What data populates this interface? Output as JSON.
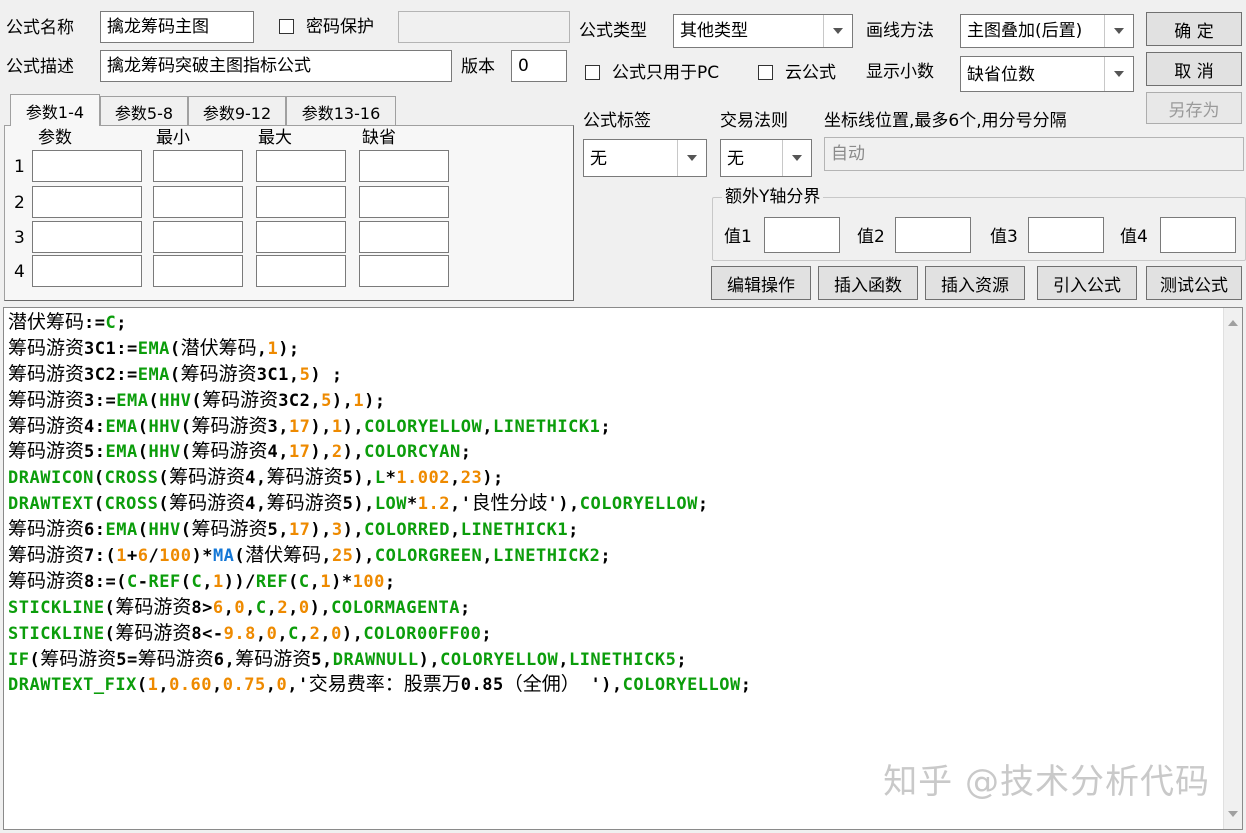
{
  "formula": {
    "name_label": "公式名称",
    "name_value": "擒龙筹码主图",
    "password_label": "密码保护",
    "password_value": "",
    "desc_label": "公式描述",
    "desc_value": "擒龙筹码突破主图指标公式",
    "version_label": "版本",
    "version_value": "0",
    "type_label": "公式类型",
    "type_value": "其他类型",
    "draw_label": "画线方法",
    "draw_value": "主图叠加(后置)",
    "pc_only_label": "公式只用于PC",
    "cloud_label": "云公式",
    "decimals_label": "显示小数",
    "decimals_value": "缺省位数",
    "tag_label": "公式标签",
    "tag_value": "无",
    "trade_rule_label": "交易法则",
    "trade_rule_value": "无",
    "axis_label": "坐标线位置,最多6个,用分号分隔",
    "axis_value": "自动",
    "yaxis_group_label": "额外Y轴分界",
    "yaxis_values": [
      "值1",
      "值2",
      "值3",
      "值4"
    ]
  },
  "buttons": {
    "ok": "确  定",
    "cancel": "取  消",
    "save_as": "另存为",
    "edit_ops": "编辑操作",
    "insert_func": "插入函数",
    "insert_res": "插入资源",
    "import_formula": "引入公式",
    "test_formula": "测试公式"
  },
  "params": {
    "tabs": [
      "参数1-4",
      "参数5-8",
      "参数9-12",
      "参数13-16"
    ],
    "headers": [
      "参数",
      "最小",
      "最大",
      "缺省"
    ],
    "rows": [
      "1",
      "2",
      "3",
      "4"
    ]
  },
  "code": [
    [
      [
        "v",
        "潜伏筹码"
      ],
      [
        "op",
        ":="
      ],
      [
        "f",
        "C"
      ],
      [
        "op",
        ";"
      ]
    ],
    [
      [
        "v",
        "筹码游资"
      ],
      [
        "op",
        "3C1:="
      ],
      [
        "f",
        "EMA"
      ],
      [
        "op",
        "("
      ],
      [
        "v",
        "潜伏筹码"
      ],
      [
        "op",
        ","
      ],
      [
        "n",
        "1"
      ],
      [
        "op",
        ");"
      ]
    ],
    [
      [
        "v",
        "筹码游资"
      ],
      [
        "op",
        "3C2:="
      ],
      [
        "f",
        "EMA"
      ],
      [
        "op",
        "("
      ],
      [
        "v",
        "筹码游资"
      ],
      [
        "op",
        "3C1,"
      ],
      [
        "n",
        "5"
      ],
      [
        "op",
        ") ;"
      ]
    ],
    [
      [
        "v",
        "筹码游资"
      ],
      [
        "op",
        "3:="
      ],
      [
        "f",
        "EMA"
      ],
      [
        "op",
        "("
      ],
      [
        "f",
        "HHV"
      ],
      [
        "op",
        "("
      ],
      [
        "v",
        "筹码游资"
      ],
      [
        "op",
        "3C2,"
      ],
      [
        "n",
        "5"
      ],
      [
        "op",
        "),"
      ],
      [
        "n",
        "1"
      ],
      [
        "op",
        ");"
      ]
    ],
    [
      [
        "v",
        "筹码游资"
      ],
      [
        "op",
        "4:"
      ],
      [
        "f",
        "EMA"
      ],
      [
        "op",
        "("
      ],
      [
        "f",
        "HHV"
      ],
      [
        "op",
        "("
      ],
      [
        "v",
        "筹码游资"
      ],
      [
        "op",
        "3,"
      ],
      [
        "n",
        "17"
      ],
      [
        "op",
        "),"
      ],
      [
        "n",
        "1"
      ],
      [
        "op",
        "),"
      ],
      [
        "c",
        "COLORYELLOW"
      ],
      [
        "op",
        ","
      ],
      [
        "c",
        "LINETHICK1"
      ],
      [
        "op",
        ";"
      ]
    ],
    [
      [
        "v",
        "筹码游资"
      ],
      [
        "op",
        "5:"
      ],
      [
        "f",
        "EMA"
      ],
      [
        "op",
        "("
      ],
      [
        "f",
        "HHV"
      ],
      [
        "op",
        "("
      ],
      [
        "v",
        "筹码游资"
      ],
      [
        "op",
        "4,"
      ],
      [
        "n",
        "17"
      ],
      [
        "op",
        "),"
      ],
      [
        "n",
        "2"
      ],
      [
        "op",
        "),"
      ],
      [
        "c",
        "COLORCYAN"
      ],
      [
        "op",
        ";"
      ]
    ],
    [
      [
        "f",
        "DRAWICON"
      ],
      [
        "op",
        "("
      ],
      [
        "f",
        "CROSS"
      ],
      [
        "op",
        "("
      ],
      [
        "v",
        "筹码游资"
      ],
      [
        "op",
        "4,"
      ],
      [
        "v",
        "筹码游资"
      ],
      [
        "op",
        "5),"
      ],
      [
        "f",
        "L"
      ],
      [
        "op",
        "*"
      ],
      [
        "n",
        "1.002"
      ],
      [
        "op",
        ","
      ],
      [
        "n",
        "23"
      ],
      [
        "op",
        ");"
      ]
    ],
    [
      [
        "f",
        "DRAWTEXT"
      ],
      [
        "op",
        "("
      ],
      [
        "f",
        "CROSS"
      ],
      [
        "op",
        "("
      ],
      [
        "v",
        "筹码游资"
      ],
      [
        "op",
        "4,"
      ],
      [
        "v",
        "筹码游资"
      ],
      [
        "op",
        "5),"
      ],
      [
        "f",
        "LOW"
      ],
      [
        "op",
        "*"
      ],
      [
        "n",
        "1.2"
      ],
      [
        "op",
        ",'"
      ],
      [
        "s",
        "良性分歧"
      ],
      [
        "op",
        "'),"
      ],
      [
        "c",
        "COLORYELLOW"
      ],
      [
        "op",
        ";"
      ]
    ],
    [
      [
        "v",
        "筹码游资"
      ],
      [
        "op",
        "6:"
      ],
      [
        "f",
        "EMA"
      ],
      [
        "op",
        "("
      ],
      [
        "f",
        "HHV"
      ],
      [
        "op",
        "("
      ],
      [
        "v",
        "筹码游资"
      ],
      [
        "op",
        "5,"
      ],
      [
        "n",
        "17"
      ],
      [
        "op",
        "),"
      ],
      [
        "n",
        "3"
      ],
      [
        "op",
        "),"
      ],
      [
        "c",
        "COLORRED"
      ],
      [
        "op",
        ","
      ],
      [
        "c",
        "LINETHICK1"
      ],
      [
        "op",
        ";"
      ]
    ],
    [
      [
        "v",
        "筹码游资"
      ],
      [
        "op",
        "7:("
      ],
      [
        "n",
        "1"
      ],
      [
        "op",
        "+"
      ],
      [
        "n",
        "6"
      ],
      [
        "op",
        "/"
      ],
      [
        "n",
        "100"
      ],
      [
        "op",
        ")*"
      ],
      [
        "b",
        "MA"
      ],
      [
        "op",
        "("
      ],
      [
        "v",
        "潜伏筹码"
      ],
      [
        "op",
        ","
      ],
      [
        "n",
        "25"
      ],
      [
        "op",
        "),"
      ],
      [
        "c",
        "COLORGREEN"
      ],
      [
        "op",
        ","
      ],
      [
        "c",
        "LINETHICK2"
      ],
      [
        "op",
        ";"
      ]
    ],
    [
      [
        "v",
        "筹码游资"
      ],
      [
        "op",
        "8:=("
      ],
      [
        "f",
        "C"
      ],
      [
        "op",
        "-"
      ],
      [
        "f",
        "REF"
      ],
      [
        "op",
        "("
      ],
      [
        "f",
        "C"
      ],
      [
        "op",
        ","
      ],
      [
        "n",
        "1"
      ],
      [
        "op",
        "))/"
      ],
      [
        "f",
        "REF"
      ],
      [
        "op",
        "("
      ],
      [
        "f",
        "C"
      ],
      [
        "op",
        ","
      ],
      [
        "n",
        "1"
      ],
      [
        "op",
        ")*"
      ],
      [
        "n",
        "100"
      ],
      [
        "op",
        ";"
      ]
    ],
    [
      [
        "f",
        "STICKLINE"
      ],
      [
        "op",
        "("
      ],
      [
        "v",
        "筹码游资"
      ],
      [
        "op",
        "8>"
      ],
      [
        "n",
        "6"
      ],
      [
        "op",
        ","
      ],
      [
        "n",
        "0"
      ],
      [
        "op",
        ","
      ],
      [
        "f",
        "C"
      ],
      [
        "op",
        ","
      ],
      [
        "n",
        "2"
      ],
      [
        "op",
        ","
      ],
      [
        "n",
        "0"
      ],
      [
        "op",
        "),"
      ],
      [
        "c",
        "COLORMAGENTA"
      ],
      [
        "op",
        ";"
      ]
    ],
    [
      [
        "f",
        "STICKLINE"
      ],
      [
        "op",
        "("
      ],
      [
        "v",
        "筹码游资"
      ],
      [
        "op",
        "8<-"
      ],
      [
        "n",
        "9.8"
      ],
      [
        "op",
        ","
      ],
      [
        "n",
        "0"
      ],
      [
        "op",
        ","
      ],
      [
        "f",
        "C"
      ],
      [
        "op",
        ","
      ],
      [
        "n",
        "2"
      ],
      [
        "op",
        ","
      ],
      [
        "n",
        "0"
      ],
      [
        "op",
        "),"
      ],
      [
        "c",
        "COLOR00FF00"
      ],
      [
        "op",
        ";"
      ]
    ],
    [
      [
        "f",
        "IF"
      ],
      [
        "op",
        "("
      ],
      [
        "v",
        "筹码游资"
      ],
      [
        "op",
        "5="
      ],
      [
        "v",
        "筹码游资"
      ],
      [
        "op",
        "6,"
      ],
      [
        "v",
        "筹码游资"
      ],
      [
        "op",
        "5,"
      ],
      [
        "c",
        "DRAWNULL"
      ],
      [
        "op",
        "),"
      ],
      [
        "c",
        "COLORYELLOW"
      ],
      [
        "op",
        ","
      ],
      [
        "c",
        "LINETHICK5"
      ],
      [
        "op",
        ";"
      ]
    ],
    [
      [
        "f",
        "DRAWTEXT_FIX"
      ],
      [
        "op",
        "("
      ],
      [
        "n",
        "1"
      ],
      [
        "op",
        ","
      ],
      [
        "n",
        "0.60"
      ],
      [
        "op",
        ","
      ],
      [
        "n",
        "0.75"
      ],
      [
        "op",
        ","
      ],
      [
        "n",
        "0"
      ],
      [
        "op",
        ",'"
      ],
      [
        "s",
        "交易费率：股票万"
      ],
      [
        "op",
        "0.85"
      ],
      [
        "s",
        "（全佣）"
      ],
      [
        "op",
        " '),"
      ],
      [
        "c",
        "COLORYELLOW"
      ],
      [
        "op",
        ";"
      ]
    ]
  ],
  "watermark": "知乎 @技术分析代码"
}
